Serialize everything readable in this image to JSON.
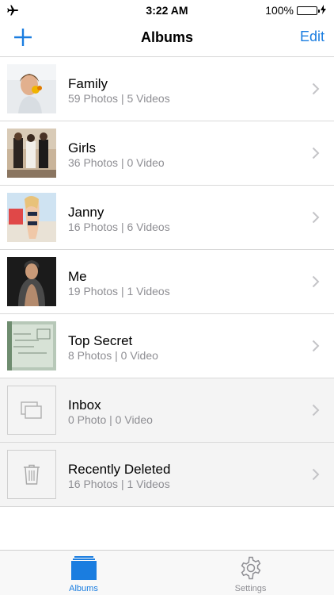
{
  "status": {
    "time": "3:22 AM",
    "battery": "100%"
  },
  "nav": {
    "title": "Albums",
    "edit_label": "Edit"
  },
  "albums": [
    {
      "title": "Family",
      "subtitle": "59 Photos | 5 Videos"
    },
    {
      "title": "Girls",
      "subtitle": "36 Photos | 0 Video"
    },
    {
      "title": "Janny",
      "subtitle": "16 Photos | 6 Videos"
    },
    {
      "title": "Me",
      "subtitle": "19 Photos | 1 Videos"
    },
    {
      "title": "Top Secret",
      "subtitle": "8 Photos | 0 Video"
    },
    {
      "title": "Inbox",
      "subtitle": "0 Photo | 0 Video"
    },
    {
      "title": "Recently Deleted",
      "subtitle": "16 Photos | 1 Videos"
    }
  ],
  "tabs": [
    {
      "label": "Albums",
      "icon": "albums-icon"
    },
    {
      "label": "Settings",
      "icon": "gear-icon"
    }
  ],
  "colors": {
    "accent": "#1a7de0",
    "battery": "#4cd964"
  }
}
